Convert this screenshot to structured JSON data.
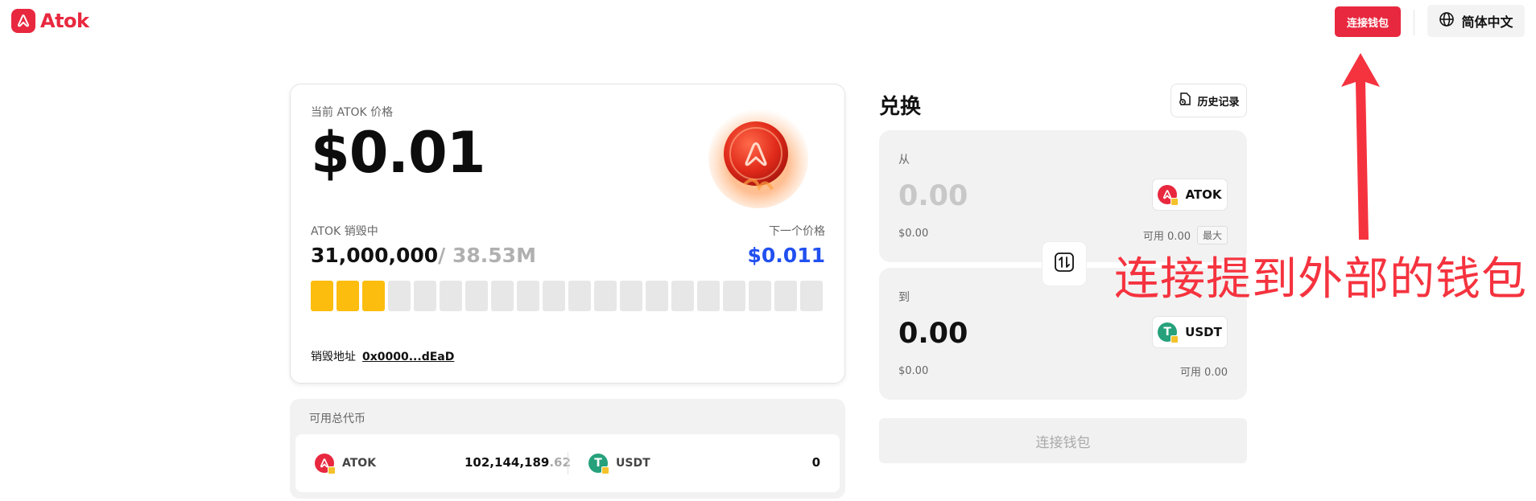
{
  "header": {
    "logo_text": "Atok",
    "connect_wallet": "连接钱包",
    "language": "简体中文"
  },
  "price_card": {
    "price_label": "当前 ATOK 价格",
    "price": "$0.01",
    "burning_label": "ATOK 销毁中",
    "burned_amount": "31,000,000",
    "burn_total": "/ 38.53M",
    "next_price_label": "下一个价格",
    "next_price": "$0.011",
    "progress": {
      "filled": 3,
      "total": 20
    },
    "burn_address_label": "销毁地址",
    "burn_address": "0x0000...dEaD"
  },
  "balances": {
    "title": "可用总代币",
    "items": [
      {
        "token": "ATOK",
        "amount_main": "102,144,189",
        "amount_dec": ".62"
      },
      {
        "token": "USDT",
        "amount_main": "0"
      }
    ]
  },
  "swap": {
    "title": "兑换",
    "history_label": "历史记录",
    "from": {
      "label": "从",
      "amount": "0.00",
      "usd": "$0.00",
      "token": "ATOK",
      "available": "可用 0.00",
      "max_label": "最大"
    },
    "to": {
      "label": "到",
      "amount": "0.00",
      "usd": "$0.00",
      "token": "USDT",
      "available": "可用 0.00"
    },
    "connect_button": "连接钱包"
  },
  "annotation": {
    "text": "连接提到外部的钱包",
    "color": "#f5333f"
  },
  "colors": {
    "brand": "#e8283f",
    "progress_fill": "#fcbd0f",
    "next_price": "#2150f0"
  }
}
